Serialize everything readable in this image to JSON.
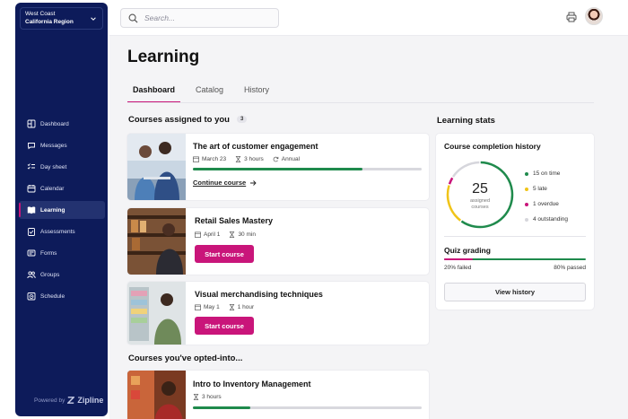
{
  "region": {
    "line1": "West Coast",
    "line2": "California Region"
  },
  "nav": [
    {
      "label": "Dashboard"
    },
    {
      "label": "Messages"
    },
    {
      "label": "Day sheet"
    },
    {
      "label": "Calendar"
    },
    {
      "label": "Learning",
      "active": true
    },
    {
      "label": "Assessments"
    },
    {
      "label": "Forms"
    },
    {
      "label": "Groups"
    },
    {
      "label": "Schedule"
    }
  ],
  "powered": {
    "prefix": "Powered by",
    "brand": "Zipline"
  },
  "search": {
    "placeholder": "Search..."
  },
  "page": {
    "title": "Learning"
  },
  "tabs": [
    {
      "label": "Dashboard",
      "active": true
    },
    {
      "label": "Catalog"
    },
    {
      "label": "History"
    }
  ],
  "assigned": {
    "title": "Courses assigned to you",
    "count": "3",
    "courses": [
      {
        "title": "The art of customer engagement",
        "date": "March 23",
        "duration": "3 hours",
        "recurrence": "Annual",
        "progress": 0.74,
        "action": "Continue course"
      },
      {
        "title": "Retail Sales Mastery",
        "date": "April 1",
        "duration": "30 min",
        "action": "Start course"
      },
      {
        "title": "Visual merchandising techniques",
        "date": "May 1",
        "duration": "1 hour",
        "action": "Start course"
      }
    ]
  },
  "opted": {
    "title": "Courses you've opted-into...",
    "courses": [
      {
        "title": "Intro to Inventory Management",
        "duration": "3 hours",
        "progress": 0.25
      }
    ]
  },
  "stats": {
    "title": "Learning stats",
    "completion": {
      "title": "Course completion history",
      "total": "25",
      "total_label_1": "assigned",
      "total_label_2": "courses",
      "legend": [
        {
          "label": "15 on time",
          "color": "#1f8a4c",
          "value": 15
        },
        {
          "label": "5 late",
          "color": "#f0c419",
          "value": 5
        },
        {
          "label": "1 overdue",
          "color": "#c9157a",
          "value": 1
        },
        {
          "label": "4 outstanding",
          "color": "#d6d6dc",
          "value": 4
        }
      ]
    },
    "quiz": {
      "title": "Quiz grading",
      "failed": "20% failed",
      "passed": "80% passed",
      "failed_fraction": 0.2
    },
    "view_history": "View history"
  }
}
